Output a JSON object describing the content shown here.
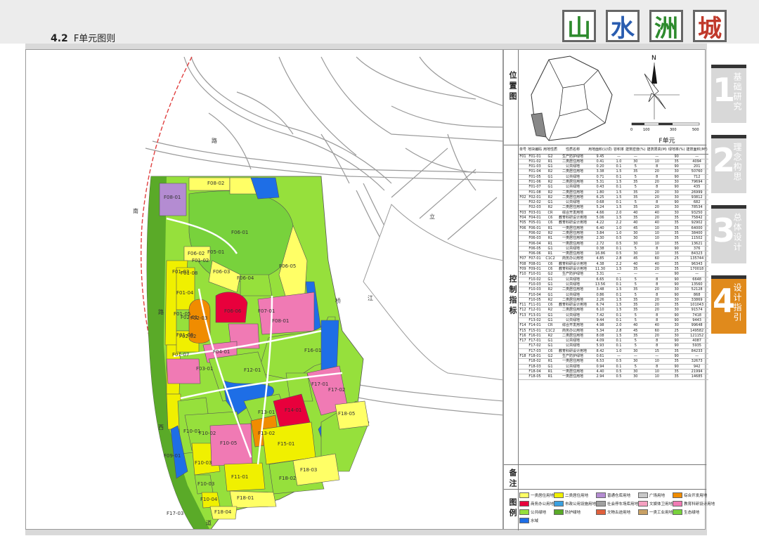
{
  "header": {
    "section_number": "4.2",
    "section_title": "F单元图则",
    "brand_chars": [
      "山",
      "水",
      "洲",
      "城"
    ],
    "brand_colors": [
      "#2e8b2e",
      "#2a5db0",
      "#2e8b2e",
      "#c0392b"
    ]
  },
  "side_labels": {
    "location": "位置图",
    "control": "控制指标",
    "remarks": "备注",
    "legend": "图例"
  },
  "locator": {
    "unit_label": "F单元",
    "scale_ticks": [
      "0",
      "100",
      "300",
      "500"
    ],
    "compass_n": "N"
  },
  "table": {
    "headers": [
      "单号",
      "地块编码",
      "用地性质",
      "性质名称",
      "用地面积(公顷)",
      "容积率",
      "建筑密度(%)",
      "建筑限高(M)",
      "绿地率(%)",
      "建筑面积(M²)"
    ],
    "rows": [
      [
        "F01",
        "F01-01",
        "G2",
        "生产防护绿地",
        "9.45",
        "—",
        "—",
        "—",
        "90",
        "—"
      ],
      [
        "",
        "F01-02",
        "R1",
        "二类居住用地",
        "0.41",
        "1.0",
        "30",
        "10",
        "35",
        "4094"
      ],
      [
        "",
        "F01-03",
        "G1",
        "公共绿地",
        "0.20",
        "0.1",
        "5",
        "8",
        "90",
        "201"
      ],
      [
        "",
        "F01-04",
        "R2",
        "二类居住用地",
        "3.38",
        "1.5",
        "35",
        "20",
        "30",
        "50760"
      ],
      [
        "",
        "F01-05",
        "G1",
        "公共绿地",
        "0.71",
        "0.1",
        "5",
        "8",
        "90",
        "712"
      ],
      [
        "",
        "F01-06",
        "R2",
        "二类居住用地",
        "5.31",
        "1.5",
        "35",
        "20",
        "30",
        "79694"
      ],
      [
        "",
        "F01-07",
        "G1",
        "公共绿地",
        "0.43",
        "0.1",
        "5",
        "8",
        "90",
        "435"
      ],
      [
        "",
        "F01-08",
        "R2",
        "二类居住用地",
        "1.80",
        "1.5",
        "35",
        "20",
        "30",
        "26999"
      ],
      [
        "F02",
        "F02-01",
        "R2",
        "二类居住用地",
        "6.25",
        "1.5",
        "35",
        "20",
        "30",
        "93812"
      ],
      [
        "",
        "F02-02",
        "G1",
        "公共绿地",
        "0.68",
        "0.1",
        "5",
        "8",
        "90",
        "682"
      ],
      [
        "",
        "F02-03",
        "R2",
        "二类居住用地",
        "5.24",
        "1.5",
        "35",
        "20",
        "30",
        "78534"
      ],
      [
        "F03",
        "F03-01",
        "CR",
        "综合开发用地",
        "4.66",
        "2.0",
        "40",
        "40",
        "30",
        "93250"
      ],
      [
        "F04",
        "F04-01",
        "C6",
        "教育科研设计用地",
        "5.06",
        "1.5",
        "35",
        "20",
        "35",
        "75842"
      ],
      [
        "F05",
        "F05-01",
        "C6",
        "教育科研设计用地",
        "4.22",
        "2.2",
        "40",
        "40",
        "35",
        "92902"
      ],
      [
        "F06",
        "F06-01",
        "R1",
        "一类居住用地",
        "6.40",
        "1.0",
        "45",
        "10",
        "35",
        "64000"
      ],
      [
        "",
        "F06-02",
        "R2",
        "二类居住用地",
        "3.84",
        "1.0",
        "30",
        "10",
        "35",
        "38400"
      ],
      [
        "",
        "F06-03",
        "R1",
        "一类居住用地",
        "2.30",
        "0.5",
        "30",
        "10",
        "35",
        "11502"
      ],
      [
        "",
        "F06-04",
        "R1",
        "一类居住用地",
        "2.72",
        "0.5",
        "30",
        "10",
        "35",
        "13621"
      ],
      [
        "",
        "F06-05",
        "G1",
        "公共绿地",
        "0.38",
        "0.1",
        "5",
        "8",
        "90",
        "376"
      ],
      [
        "",
        "F06-06",
        "R1",
        "一类居住用地",
        "16.86",
        "0.5",
        "30",
        "10",
        "35",
        "84323"
      ],
      [
        "F07",
        "F07-01",
        "C1C2",
        "商务办公用地",
        "4.85",
        "2.8",
        "45",
        "60",
        "25",
        "135744"
      ],
      [
        "F08",
        "F08-01",
        "C6",
        "教育科研设计用地",
        "4.38",
        "2.2",
        "40",
        "40",
        "35",
        "96343"
      ],
      [
        "F09",
        "F09-01",
        "C6",
        "教育科研设计用地",
        "11.30",
        "1.5",
        "35",
        "20",
        "35",
        "170018"
      ],
      [
        "F10",
        "F10-01",
        "G2",
        "生产防护绿地",
        "3.31",
        "—",
        "—",
        "—",
        "90",
        "—"
      ],
      [
        "",
        "F10-02",
        "G1",
        "公共绿地",
        "6.65",
        "0.1",
        "5",
        "8",
        "90",
        "6648"
      ],
      [
        "",
        "F10-03",
        "G1",
        "公共绿地",
        "13.56",
        "0.1",
        "5",
        "8",
        "90",
        "13560"
      ],
      [
        "",
        "F10-03",
        "R2",
        "二类居住用地",
        "3.48",
        "1.5",
        "35",
        "20",
        "30",
        "52128"
      ],
      [
        "",
        "F10-04",
        "G1",
        "公共绿地",
        "0.86",
        "0.1",
        "5",
        "8",
        "90",
        "868"
      ],
      [
        "",
        "F10-05",
        "R2",
        "二类居住用地",
        "2.26",
        "1.5",
        "35",
        "20",
        "30",
        "33869"
      ],
      [
        "F11",
        "F11-01",
        "C6",
        "教育科研设计用地",
        "6.74",
        "1.5",
        "35",
        "20",
        "35",
        "101043"
      ],
      [
        "F12",
        "F12-01",
        "R2",
        "二类居住用地",
        "6.10",
        "1.5",
        "35",
        "20",
        "30",
        "91574"
      ],
      [
        "F13",
        "F13-01",
        "G1",
        "公共绿地",
        "7.42",
        "0.1",
        "5",
        "8",
        "90",
        "7418"
      ],
      [
        "",
        "F13-02",
        "G1",
        "公共绿地",
        "9.44",
        "0.1",
        "5",
        "8",
        "90",
        "9443"
      ],
      [
        "F14",
        "F14-01",
        "CR",
        "综合开发用地",
        "4.98",
        "2.0",
        "40",
        "40",
        "30",
        "99648"
      ],
      [
        "F15",
        "F15-01",
        "C1C2",
        "商务办公用地",
        "5.34",
        "2.8",
        "45",
        "60",
        "25",
        "149582"
      ],
      [
        "F16",
        "F16-01",
        "R2",
        "二类居住用地",
        "8.08",
        "1.5",
        "35",
        "20",
        "30",
        "121152"
      ],
      [
        "F17",
        "F17-01",
        "G1",
        "公共绿地",
        "4.09",
        "0.1",
        "5",
        "8",
        "90",
        "4087"
      ],
      [
        "",
        "F17-02",
        "G1",
        "公共绿地",
        "5.93",
        "0.1",
        "5",
        "8",
        "90",
        "5935"
      ],
      [
        "",
        "F17-03",
        "C6",
        "教育科研设计用地",
        "8.42",
        "1.0",
        "30",
        "15",
        "35",
        "84233"
      ],
      [
        "F18",
        "F18-01",
        "G2",
        "生产防护绿地",
        "0.61",
        "—",
        "—",
        "—",
        "90",
        "—"
      ],
      [
        "",
        "F18-02",
        "R1",
        "一类居住用地",
        "6.53",
        "0.5",
        "30",
        "10",
        "35",
        "32673"
      ],
      [
        "",
        "F18-03",
        "G1",
        "公共绿地",
        "0.94",
        "0.1",
        "5",
        "8",
        "90",
        "942"
      ],
      [
        "",
        "F18-04",
        "R1",
        "一类居住用地",
        "4.40",
        "0.5",
        "30",
        "10",
        "35",
        "21994"
      ],
      [
        "",
        "F18-05",
        "R1",
        "一类居住用地",
        "2.94",
        "0.5",
        "30",
        "10",
        "35",
        "14685"
      ]
    ]
  },
  "legend": [
    {
      "label": "一类居住用地",
      "color": "#ffff66"
    },
    {
      "label": "二类居住用地",
      "color": "#f0f000"
    },
    {
      "label": "普通仓库用地",
      "color": "#b48cd2"
    },
    {
      "label": "广场用地",
      "color": "#c8c8c8"
    },
    {
      "label": "综合开发用地",
      "color": "#f08c00"
    },
    {
      "label": "商务办公用地",
      "color": "#e8003c"
    },
    {
      "label": "市政公用设施用地",
      "color": "#3aa0e0"
    },
    {
      "label": "社会停车场库用地",
      "color": "#a0a0a0"
    },
    {
      "label": "文娱体卫用地",
      "color": "#f5a0c0"
    },
    {
      "label": "教育科研设计用地",
      "color": "#f07ab4"
    },
    {
      "label": "公共绿地",
      "color": "#96e03c"
    },
    {
      "label": "防护绿地",
      "color": "#5aaa28"
    },
    {
      "label": "文物古迹用地",
      "color": "#e0603c"
    },
    {
      "label": "一类工业用地",
      "color": "#c8a064"
    },
    {
      "label": "生态绿地",
      "color": "#78d23c"
    },
    {
      "label": "水域",
      "color": "#1e6ee6"
    }
  ],
  "nav": [
    {
      "num": "1",
      "text": "基础研究",
      "active": false
    },
    {
      "num": "2",
      "text": "理念构思",
      "active": false
    },
    {
      "num": "3",
      "text": "总体设计",
      "active": false
    },
    {
      "num": "4",
      "text": "设计指引",
      "active": true
    }
  ],
  "map": {
    "road_labels": [
      "路",
      "路",
      "西",
      "道",
      "桥",
      "立",
      "江",
      "南"
    ],
    "parcels": [
      {
        "id": "F08-01",
        "color": "#b48cd2"
      },
      {
        "id": "F08-02",
        "color": "#ffff66"
      },
      {
        "id": "F06-01",
        "color": "#96e03c"
      },
      {
        "id": "F01-02",
        "color": "#f0f000"
      },
      {
        "id": "F01-03",
        "color": "#96e03c"
      },
      {
        "id": "F01-04",
        "color": "#f0f000"
      },
      {
        "id": "F01-05",
        "color": "#96e03c"
      },
      {
        "id": "F01-06",
        "color": "#f0f000"
      },
      {
        "id": "F01-07",
        "color": "#96e03c"
      },
      {
        "id": "F01-08",
        "color": "#f0f000"
      },
      {
        "id": "F02-01",
        "color": "#f0f000"
      },
      {
        "id": "F02-02",
        "color": "#96e03c"
      },
      {
        "id": "F02-03",
        "color": "#f0f000"
      },
      {
        "id": "F03-01",
        "color": "#f08c00"
      },
      {
        "id": "F04-01",
        "color": "#f07ab4"
      },
      {
        "id": "F05-01",
        "color": "#f07ab4"
      },
      {
        "id": "F06-02",
        "color": "#ffff66"
      },
      {
        "id": "F06-03",
        "color": "#ffff66"
      },
      {
        "id": "F06-04",
        "color": "#ffff66"
      },
      {
        "id": "F06-05",
        "color": "#96e03c"
      },
      {
        "id": "F06-06",
        "color": "#ffff66"
      },
      {
        "id": "F07-01",
        "color": "#e8003c"
      },
      {
        "id": "F08-01",
        "color": "#f07ab4"
      },
      {
        "id": "F09-01",
        "color": "#f07ab4"
      },
      {
        "id": "F10-01",
        "color": "#5aaa28"
      },
      {
        "id": "F10-02",
        "color": "#96e03c"
      },
      {
        "id": "F10-03",
        "color": "#96e03c"
      },
      {
        "id": "F10-03",
        "color": "#f0f000"
      },
      {
        "id": "F10-04",
        "color": "#96e03c"
      },
      {
        "id": "F10-05",
        "color": "#f0f000"
      },
      {
        "id": "F11-01",
        "color": "#f07ab4"
      },
      {
        "id": "F12-01",
        "color": "#f0f000"
      },
      {
        "id": "F13-01",
        "color": "#96e03c"
      },
      {
        "id": "F13-02",
        "color": "#96e03c"
      },
      {
        "id": "F14-01",
        "color": "#f08c00"
      },
      {
        "id": "F15-01",
        "color": "#e8003c"
      },
      {
        "id": "F16-01",
        "color": "#f0f000"
      },
      {
        "id": "F17-01",
        "color": "#96e03c"
      },
      {
        "id": "F17-02",
        "color": "#96e03c"
      },
      {
        "id": "F17-03",
        "color": "#f07ab4"
      },
      {
        "id": "F18-01",
        "color": "#5aaa28"
      },
      {
        "id": "F18-02",
        "color": "#ffff66"
      },
      {
        "id": "F18-03",
        "color": "#96e03c"
      },
      {
        "id": "F18-04",
        "color": "#ffff66"
      },
      {
        "id": "F18-05",
        "color": "#ffff66"
      }
    ]
  }
}
